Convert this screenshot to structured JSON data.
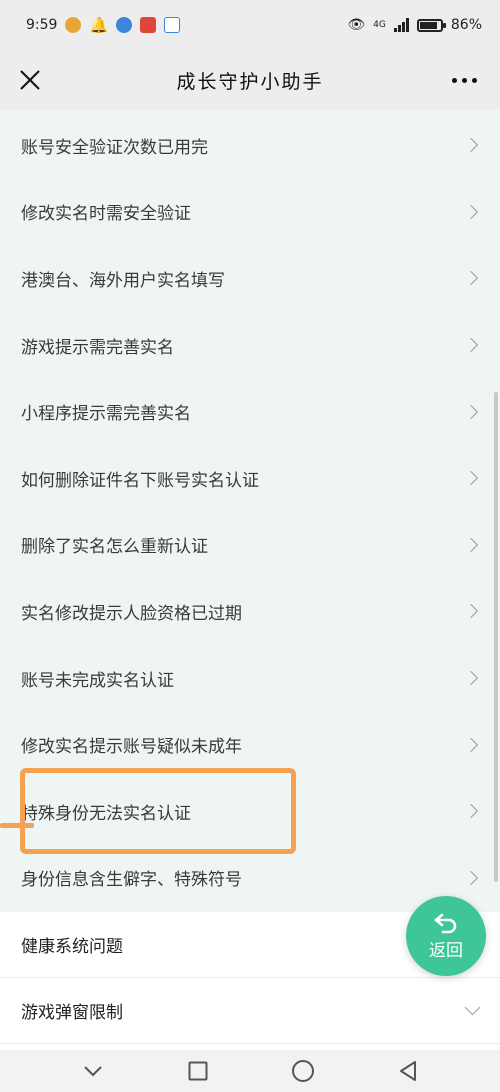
{
  "status_bar": {
    "time": "9:59",
    "network": "4G",
    "battery": "86%"
  },
  "header": {
    "title": "成长守护小助手",
    "close_icon": "close-icon",
    "more_icon": "more-icon"
  },
  "list": {
    "items": [
      {
        "label": "账号安全验证次数已用完"
      },
      {
        "label": "修改实名时需安全验证"
      },
      {
        "label": "港澳台、海外用户实名填写"
      },
      {
        "label": "游戏提示需完善实名"
      },
      {
        "label": "小程序提示需完善实名"
      },
      {
        "label": "如何删除证件名下账号实名认证"
      },
      {
        "label": "删除了实名怎么重新认证"
      },
      {
        "label": "实名修改提示人脸资格已过期"
      },
      {
        "label": "账号未完成实名认证"
      },
      {
        "label": "修改实名提示账号疑似未成年"
      },
      {
        "label": "特殊身份无法实名认证"
      },
      {
        "label": "身份信息含生僻字、特殊符号"
      }
    ]
  },
  "categories": [
    {
      "label": "健康系统问题"
    },
    {
      "label": "游戏弹窗限制"
    }
  ],
  "fab": {
    "label": "返回",
    "icon": "back-arrow-icon",
    "color": "#3fc59a"
  },
  "colors": {
    "highlight": "#f5a053",
    "list_bg": "#eef5f4"
  }
}
